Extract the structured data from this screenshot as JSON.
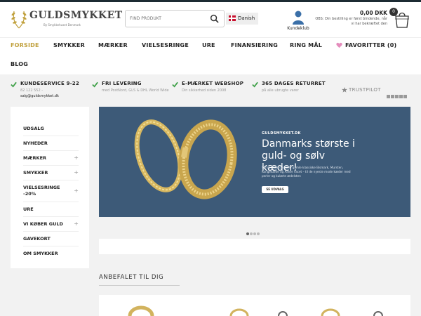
{
  "brand": {
    "name": "GULDSMYKKET",
    "tagline": "By Smykkehuset Denmark"
  },
  "colors": {
    "accent": "#c0a03c",
    "hero_bg": "#3d5a78",
    "check_green": "#3fa048",
    "kunde_blue": "#3a6fa8",
    "heart_pink": "#e48cbc"
  },
  "search": {
    "placeholder": "FIND PRODUKT",
    "icon": "search-icon"
  },
  "language": {
    "label": "Danish",
    "icon": "denmark-flag-icon"
  },
  "account": {
    "label": "Kundeklub",
    "icon": "user-icon"
  },
  "cart": {
    "total": "0,00 DKK",
    "note": "OBS: Din bestilling er først bindende, når vi har bekræftet den",
    "count": "0",
    "icon": "shopping-cart-icon"
  },
  "nav": {
    "items": [
      {
        "label": "FORSIDE",
        "active": true
      },
      {
        "label": "SMYKKER"
      },
      {
        "label": "MÆRKER"
      },
      {
        "label": "VIELSESRINGE"
      },
      {
        "label": "URE"
      },
      {
        "label": "FINANSIERING"
      },
      {
        "label": "RING MÅL"
      },
      {
        "label": "FAVORITTER (0)",
        "icon": "heart-icon"
      },
      {
        "label": "BLOG"
      }
    ]
  },
  "usp": [
    {
      "title": "KUNDESERVICE 9-22",
      "sub": "82 122 552 -",
      "link": "salg@guldsmykket.dk",
      "icon": "check-icon"
    },
    {
      "title": "FRI LEVERING",
      "sub": "med PostNord, GLS & DHL World Wide",
      "icon": "check-icon"
    },
    {
      "title": "E-MÆRKET WEBSHOP",
      "sub": "Din sikkerhed siden 2008",
      "icon": "check-icon"
    },
    {
      "title": "365 DAGES RETURRET",
      "sub": "på alle ubrugte varer",
      "icon": "check-icon"
    }
  ],
  "trustpilot": {
    "label": "TRUSTPILOT",
    "rating_stars": 5
  },
  "sidebar": {
    "items": [
      {
        "label": "UDSALG",
        "expandable": false
      },
      {
        "label": "NYHEDER",
        "expandable": false
      },
      {
        "label": "MÆRKER",
        "expandable": true
      },
      {
        "label": "SMYKKER",
        "expandable": true
      },
      {
        "label": "VIELSESRINGE -20%",
        "expandable": true
      },
      {
        "label": "URE",
        "expandable": false
      },
      {
        "label": "VI KØBER GULD",
        "expandable": true
      },
      {
        "label": "GAVEKORT",
        "expandable": false
      },
      {
        "label": "OM SMYKKER",
        "expandable": false
      }
    ],
    "expand_symbol": "+"
  },
  "hero": {
    "brand": "GULDSMYKKET.DK",
    "title": "Danmarks største i guld- og sølv kæder!",
    "body": "Vi har både de gode gamle klassiske Bismark, Mursten, Kongekæde og Anker Facet – til de nyeste mode kæder med perler og kulørte ædelsten",
    "button": "SE UDVALG",
    "slides": 4,
    "active_slide": 1
  },
  "recommended": {
    "title": "ANBEFALET TIL DIG"
  }
}
